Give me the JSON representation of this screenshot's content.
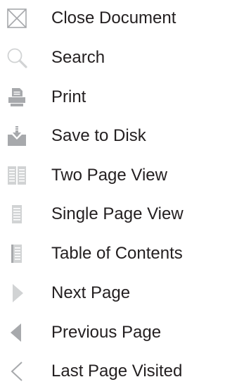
{
  "colors": {
    "icon": "#a7a9ac",
    "icon_light": "#d1d3d4",
    "text": "#231f20"
  },
  "menu": {
    "items": [
      {
        "label": "Close Document",
        "icon": "close-document-icon"
      },
      {
        "label": "Search",
        "icon": "search-icon"
      },
      {
        "label": "Print",
        "icon": "printer-icon"
      },
      {
        "label": "Save to Disk",
        "icon": "save-to-disk-icon"
      },
      {
        "label": "Two Page View",
        "icon": "two-page-view-icon"
      },
      {
        "label": "Single Page View",
        "icon": "single-page-view-icon"
      },
      {
        "label": "Table of Contents",
        "icon": "table-of-contents-icon"
      },
      {
        "label": "Next Page",
        "icon": "next-page-arrow-icon"
      },
      {
        "label": "Previous Page",
        "icon": "previous-page-arrow-icon"
      },
      {
        "label": "Last Page Visited",
        "icon": "last-page-visited-chevron-icon"
      }
    ]
  }
}
